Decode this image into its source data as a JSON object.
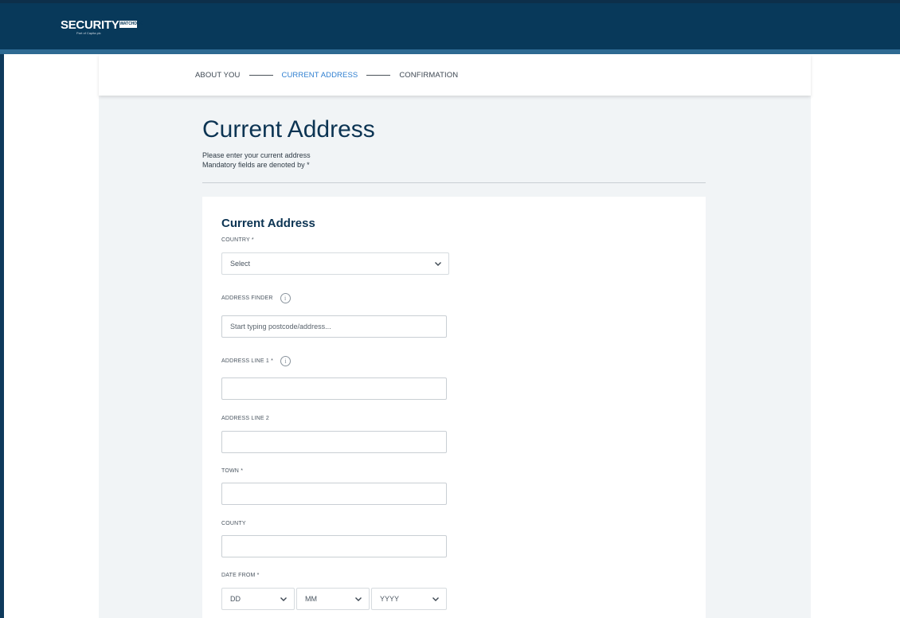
{
  "brand": {
    "logo_text": "SECURITY",
    "logo_badge": "WATCHDOG",
    "logo_sub": "Part of Capita plc"
  },
  "stepper": {
    "steps": [
      {
        "label": "ABOUT YOU",
        "active": false
      },
      {
        "label": "CURRENT ADDRESS",
        "active": true
      },
      {
        "label": "CONFIRMATION",
        "active": false
      }
    ]
  },
  "page": {
    "title": "Current Address",
    "desc_line1": "Please enter your current address",
    "desc_line2": "Mandatory fields are denoted by *"
  },
  "form": {
    "title": "Current Address",
    "country": {
      "label": "COUNTRY *",
      "value": "Select"
    },
    "address_finder": {
      "label": "ADDRESS FINDER",
      "placeholder": "Start typing postcode/address..."
    },
    "address_line1": {
      "label": "ADDRESS LINE 1 *",
      "value": ""
    },
    "address_line2": {
      "label": "ADDRESS LINE 2",
      "value": ""
    },
    "town": {
      "label": "TOWN *",
      "value": ""
    },
    "county": {
      "label": "COUNTY",
      "value": ""
    },
    "date_from": {
      "label": "DATE FROM *",
      "day": "DD",
      "month": "MM",
      "year": "YYYY"
    }
  },
  "icons": {
    "info": "info-icon",
    "chevron": "chevron-down-icon"
  },
  "colors": {
    "header": "#08395a",
    "accent": "#2f7fd0",
    "title": "#0c3453"
  }
}
